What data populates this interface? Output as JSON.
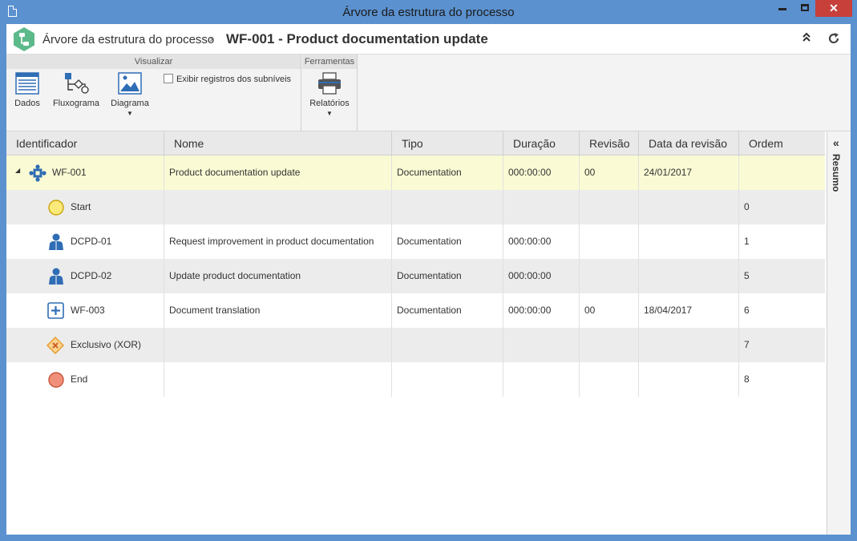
{
  "window": {
    "title": "Árvore da estrutura do processo",
    "close_symbol": "✕"
  },
  "header": {
    "breadcrumb_root": "Árvore da estrutura do processo",
    "separator": "›",
    "breadcrumb_current": "WF-001 - Product documentation update",
    "collapse_symbol": "⌃",
    "refresh_symbol": "⟳"
  },
  "ribbon": {
    "group_visualizar": "Visualizar",
    "group_ferramentas": "Ferramentas",
    "btn_dados": "Dados",
    "btn_fluxograma": "Fluxograma",
    "btn_diagrama": "Diagrama",
    "chk_subniveis": "Exibir registros dos subníveis",
    "btn_relatorios": "Relatórios",
    "caret": "▼"
  },
  "grid": {
    "columns": [
      "Identificador",
      "Nome",
      "Tipo",
      "Duração",
      "Revisão",
      "Data da revisão",
      "Ordem"
    ],
    "rows": [
      {
        "id": "WF-001",
        "nome": "Product documentation update",
        "tipo": "Documentation",
        "duracao": "000:00:00",
        "revisao": "00",
        "data": "24/01/2017",
        "ordem": "",
        "icon": "process-icon"
      },
      {
        "id": "Start",
        "nome": "",
        "tipo": "",
        "duracao": "",
        "revisao": "",
        "data": "",
        "ordem": "0",
        "icon": "start-event-icon"
      },
      {
        "id": "DCPD-01",
        "nome": "Request improvement in product documentation",
        "tipo": "Documentation",
        "duracao": "000:00:00",
        "revisao": "",
        "data": "",
        "ordem": "1",
        "icon": "user-task-icon"
      },
      {
        "id": "DCPD-02",
        "nome": "Update product documentation",
        "tipo": "Documentation",
        "duracao": "000:00:00",
        "revisao": "",
        "data": "",
        "ordem": "5",
        "icon": "user-task-icon"
      },
      {
        "id": "WF-003",
        "nome": "Document translation",
        "tipo": "Documentation",
        "duracao": "000:00:00",
        "revisao": "00",
        "data": "18/04/2017",
        "ordem": "6",
        "icon": "subprocess-icon"
      },
      {
        "id": "Exclusivo (XOR)",
        "nome": "",
        "tipo": "",
        "duracao": "",
        "revisao": "",
        "data": "",
        "ordem": "7",
        "icon": "xor-gateway-icon"
      },
      {
        "id": "End",
        "nome": "",
        "tipo": "",
        "duracao": "",
        "revisao": "",
        "data": "",
        "ordem": "8",
        "icon": "end-event-icon"
      }
    ],
    "expander": "◢"
  },
  "side_panel": {
    "label": "Resumo",
    "chevron": "«"
  },
  "colors": {
    "titlebar": "#5b91cf",
    "selected_row": "#fafbd4",
    "alt_row": "#ececec",
    "accent_blue": "#2f6db5"
  }
}
